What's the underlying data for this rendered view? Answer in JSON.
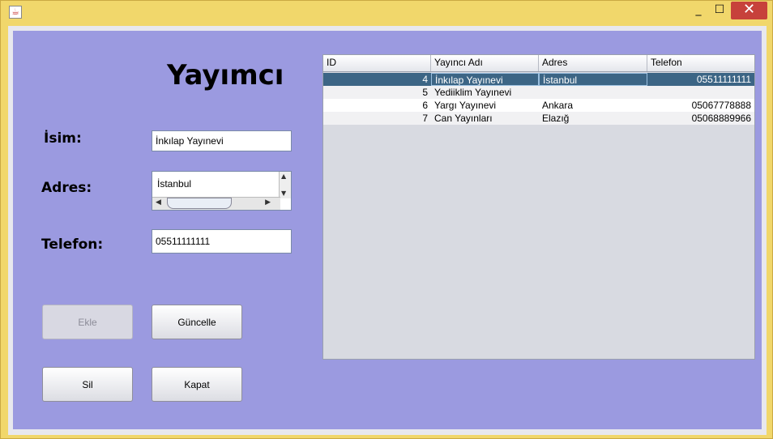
{
  "window": {
    "app_icon": "java-icon",
    "minimize": "_",
    "maximize": "☐",
    "close": "✕"
  },
  "form": {
    "title": "Yayımcı",
    "labels": {
      "name": "İsim:",
      "address": "Adres:",
      "phone": "Telefon:"
    },
    "values": {
      "name": "İnkılap Yayınevi",
      "address": "İstanbul",
      "phone": "05511111111"
    }
  },
  "buttons": {
    "add": "Ekle",
    "update": "Güncelle",
    "delete": "Sil",
    "close": "Kapat"
  },
  "table": {
    "columns": [
      "ID",
      "Yayıncı Adı",
      "Adres",
      "Telefon"
    ],
    "rows": [
      {
        "id": "4",
        "name": "İnkılap Yayınevi",
        "address": "İstanbul",
        "phone": "05511111111"
      },
      {
        "id": "5",
        "name": "Yediiklim Yayınevi",
        "address": "",
        "phone": ""
      },
      {
        "id": "6",
        "name": "Yargı Yayınevi",
        "address": "Ankara",
        "phone": "05067778888"
      },
      {
        "id": "7",
        "name": "Can Yayınları",
        "address": "Elazığ",
        "phone": "05068889966"
      }
    ],
    "selected_index": 0
  }
}
